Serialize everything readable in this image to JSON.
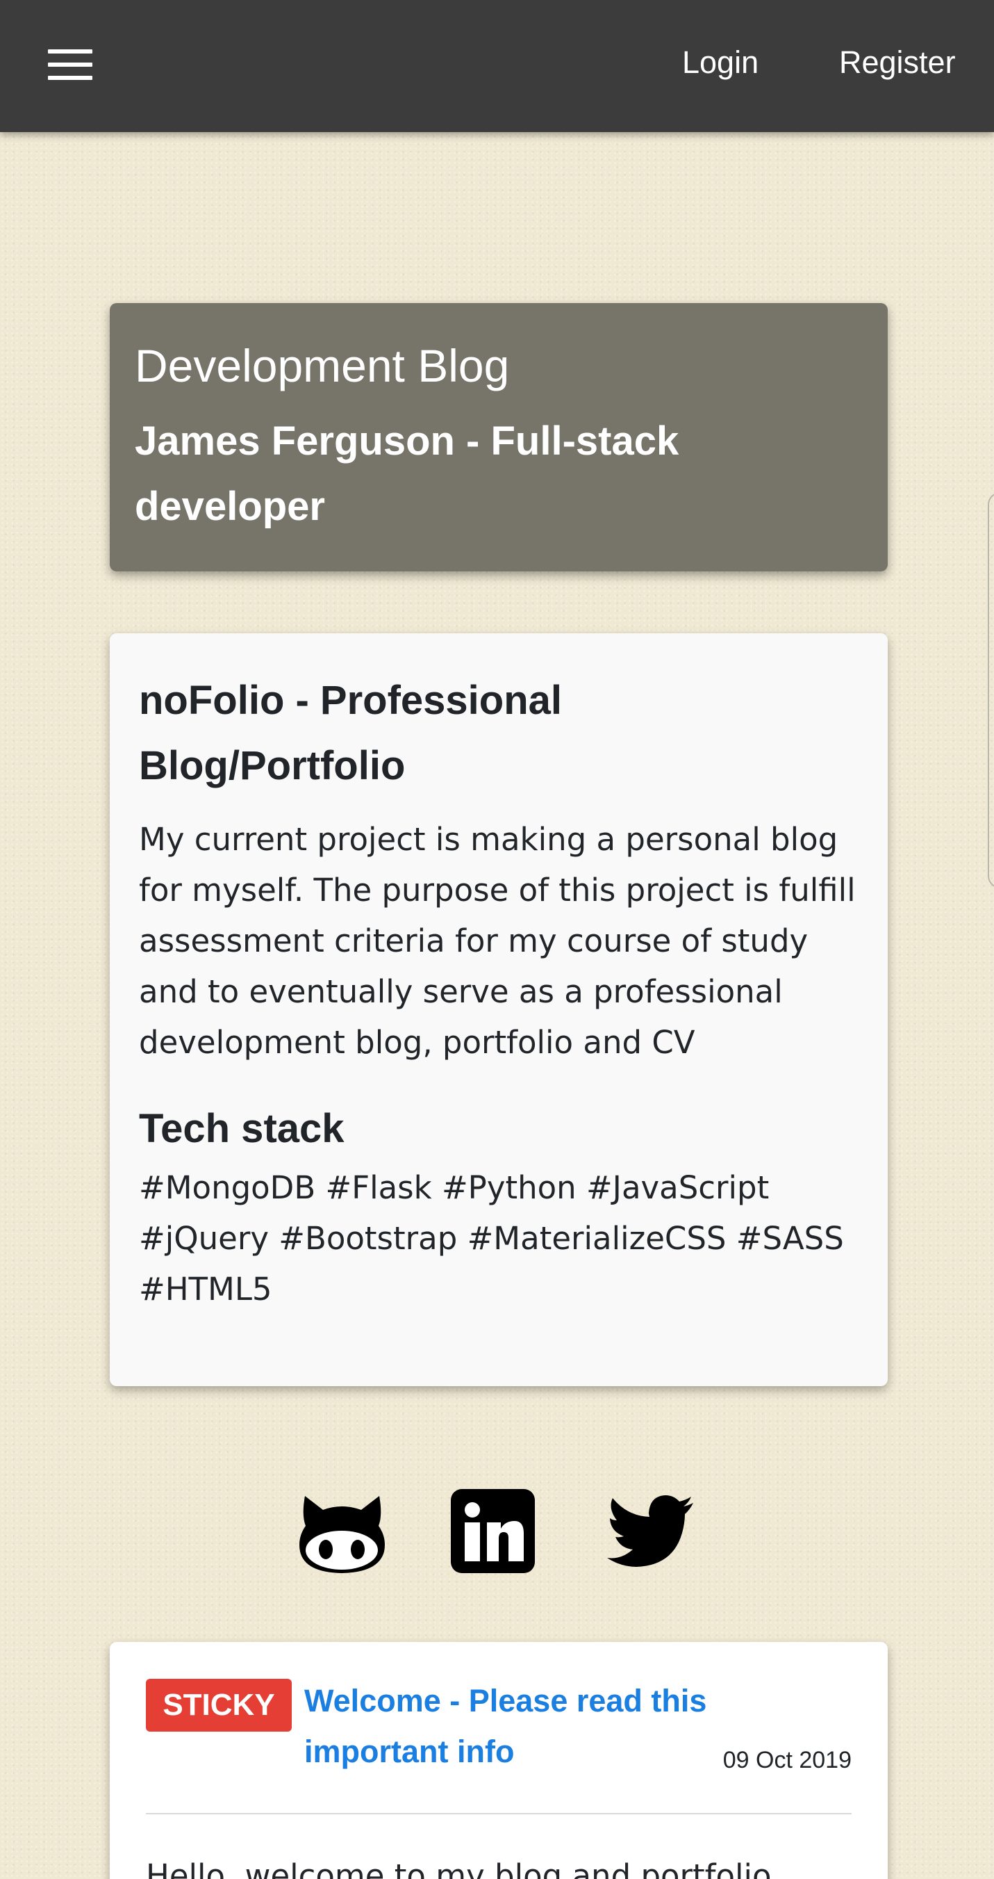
{
  "navbar": {
    "menu_icon": "hamburger-menu-icon",
    "login_label": "Login",
    "register_label": "Register"
  },
  "header": {
    "title": "Development Blog",
    "subtitle": "James Ferguson - Full-stack developer"
  },
  "project": {
    "title": "noFolio - Professional Blog/Portfolio",
    "description": "My current project is making a personal blog for myself. The purpose of this project is fulfill assessment criteria for my course of study and to eventually serve as a professional development blog, portfolio and CV",
    "stack_title": "Tech stack",
    "stack_tags": "#MongoDB #Flask #Python #JavaScript #jQuery #Bootstrap #MaterializeCSS #SASS #HTML5"
  },
  "social": {
    "icons": [
      "github-icon",
      "linkedin-icon",
      "twitter-icon"
    ]
  },
  "post": {
    "badge": "STICKY",
    "title": "Welcome - Please read this important info",
    "date": "09 Oct 2019",
    "excerpt": "Hello, welcome to my blog and portfolio"
  },
  "colors": {
    "navbar_bg": "#3c3c3c",
    "header_card_bg": "#77756a",
    "page_bg": "#efe8d2",
    "sticky_badge": "#e53e35",
    "post_link": "#1a7fe0"
  }
}
